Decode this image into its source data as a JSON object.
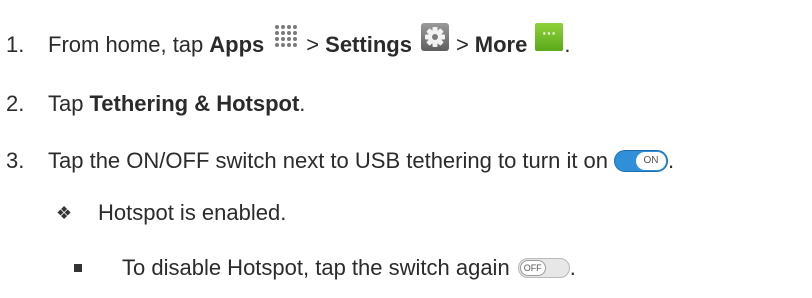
{
  "steps": [
    {
      "number": "1.",
      "text_prefix": "From home, tap",
      "apps_label": "Apps",
      "sep1": ">",
      "settings_label": "Settings",
      "sep2": ">",
      "more_label": "More",
      "end_punct": ".",
      "more_icon_text": "···"
    },
    {
      "number": "2.",
      "text_prefix": "Tap",
      "bold_label": "Tethering & Hotspot",
      "end_punct": "."
    },
    {
      "number": "3.",
      "text": "Tap the ON/OFF switch next to USB tethering to turn it on",
      "end_punct": ".",
      "toggle_label": "ON"
    }
  ],
  "result": {
    "glyph": "❖",
    "text": "Hotspot is enabled."
  },
  "note": {
    "text": "To disable Hotspot, tap the switch again",
    "end_punct": ".",
    "toggle_label": "OFF"
  },
  "icons": {
    "apps": "apps-grid-icon",
    "settings": "gear-icon",
    "more": "more-icon",
    "toggle_on": "toggle-on-icon",
    "toggle_off": "toggle-off-icon"
  },
  "colors": {
    "text": "#2b2b2b",
    "toggle_on": "#2f8fd8",
    "more_icon": "#6cbb24"
  }
}
